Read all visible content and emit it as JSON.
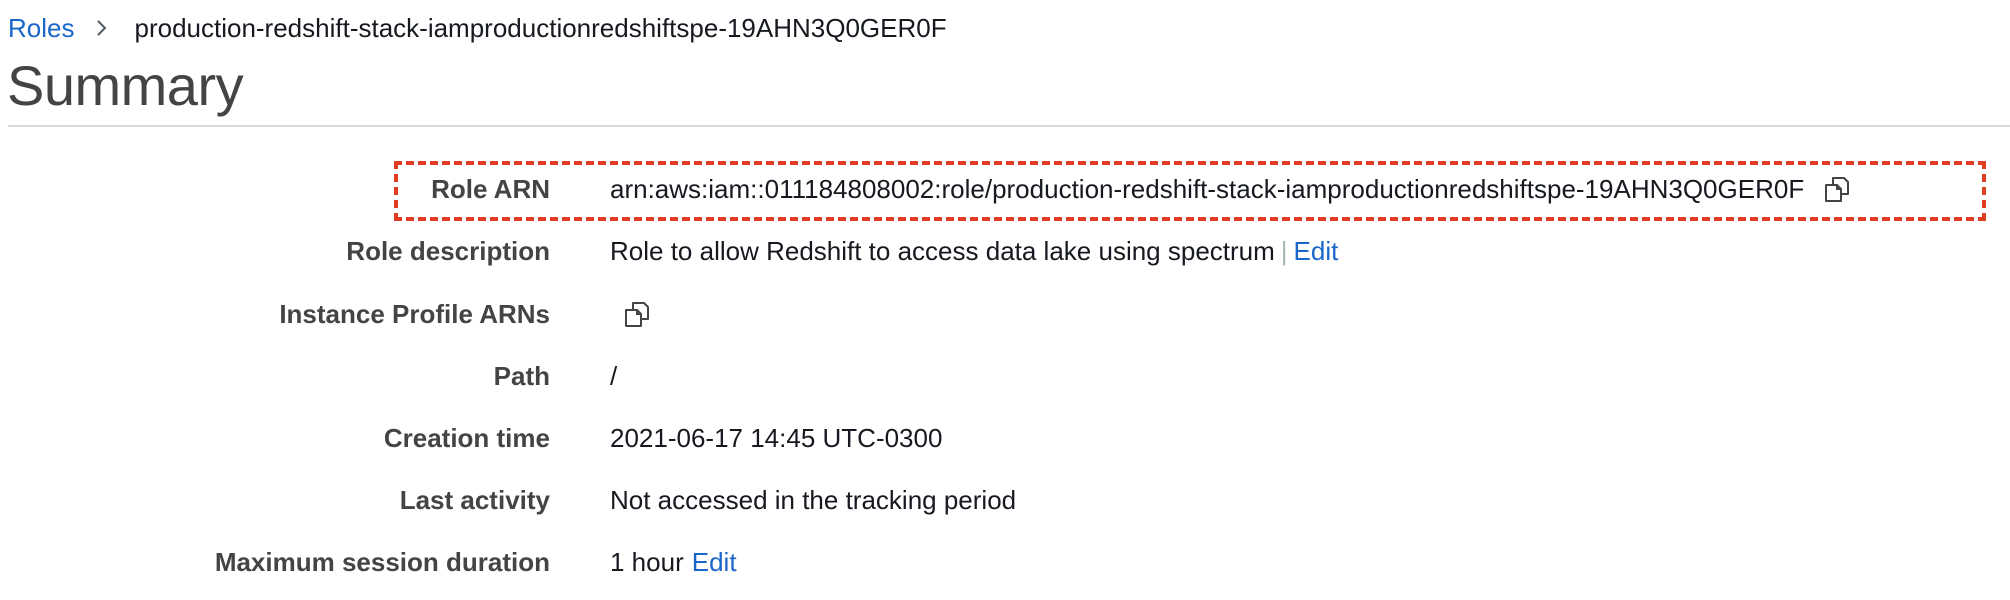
{
  "breadcrumb": {
    "root_label": "Roles",
    "current_label": "production-redshift-stack-iamproductionredshiftspe-19AHN3Q0GER0F"
  },
  "page_title": "Summary",
  "summary": {
    "role_arn": {
      "label": "Role ARN",
      "value": "arn:aws:iam::011184808002:role/production-redshift-stack-iamproductionredshiftspe-19AHN3Q0GER0F",
      "icon": "copy-icon"
    },
    "role_description": {
      "label": "Role description",
      "value": "Role to allow Redshift to access data lake using spectrum",
      "separator": "|",
      "edit_label": "Edit"
    },
    "instance_profile_arns": {
      "label": "Instance Profile ARNs",
      "icon": "copy-icon"
    },
    "path": {
      "label": "Path",
      "value": "/"
    },
    "creation_time": {
      "label": "Creation time",
      "value": "2021-06-17 14:45 UTC-0300"
    },
    "last_activity": {
      "label": "Last activity",
      "value": "Not accessed in the tracking period"
    },
    "max_session_duration": {
      "label": "Maximum session duration",
      "value": "1 hour",
      "edit_label": "Edit"
    }
  },
  "colors": {
    "link": "#1b66c9",
    "highlight_dash": "#e03c22",
    "label_text": "#444444",
    "divider": "#d5dbdb"
  }
}
